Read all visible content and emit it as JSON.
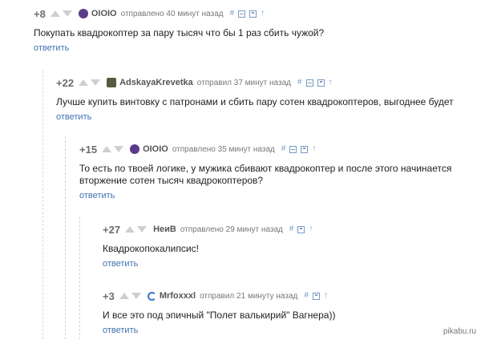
{
  "colors": {
    "reply_link": "#3e73b0",
    "username": "#555555",
    "score": "#6d6d6d",
    "tool_icons": "#7a9bc4",
    "thread_line": "#d6d6d6"
  },
  "watermark": "pikabu.ru",
  "comments": [
    {
      "score": "+8",
      "author": "OIOIO",
      "avatar_icon": "purple-avatar-icon",
      "time": "отправлено 40 минут назад",
      "tools": [
        "hash-icon",
        "minus-box-icon",
        "save-icon",
        "up-arrow-icon"
      ],
      "text": "Покупать квадрокоптер за пару тысяч что бы 1 раз сбить чужой?",
      "reply": "ответить"
    },
    {
      "score": "+22",
      "author": "AdskayaKrevetka",
      "avatar_icon": "shrimp-avatar-icon",
      "time": "отправил 37 минут назад",
      "tools": [
        "hash-icon",
        "minus-box-icon",
        "save-icon",
        "up-arrow-icon"
      ],
      "text": "Лучше купить винтовку с патронами и сбить пару сотен квадрокоптеров, выгоднее будет",
      "reply": "ответить"
    },
    {
      "score": "+15",
      "author": "OIOIO",
      "avatar_icon": "purple-avatar-icon",
      "time": "отправлено 35 минут назад",
      "tools": [
        "hash-icon",
        "minus-box-icon",
        "save-icon",
        "up-arrow-icon"
      ],
      "text_line1": "То есть по твоей логике, у мужика сбивают квадрокоптер и после этого начинается",
      "text_line2": "вторжение сотен тысяч квадрокоптеров?",
      "reply": "ответить"
    },
    {
      "score": "+27",
      "author": "НеиВ",
      "avatar_icon": "none",
      "time": "отправлено 29 минут назад",
      "tools": [
        "hash-icon",
        "save-icon",
        "up-arrow-icon"
      ],
      "text": "Квадрокопокалипсис!",
      "reply": "ответить"
    },
    {
      "score": "+3",
      "author": "Mrfoxxxl",
      "avatar_icon": "swirl-avatar-icon",
      "time": "отправил 21 минуту назад",
      "tools": [
        "hash-icon",
        "save-icon",
        "up-arrow-icon"
      ],
      "text": "И все это под эпичный \"Полет валькирий\" Вагнера))",
      "reply": "ответить"
    }
  ]
}
